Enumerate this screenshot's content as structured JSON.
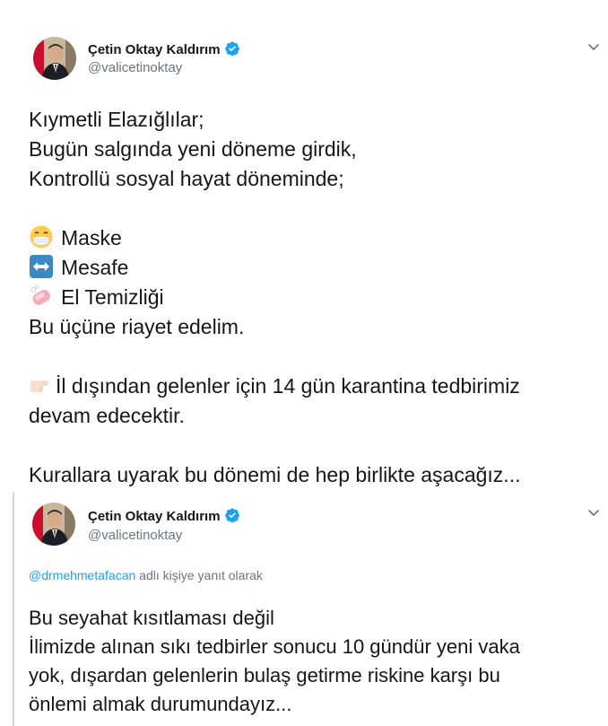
{
  "tweets": [
    {
      "author": {
        "name": "Çetin Oktay Kaldırım",
        "handle": "@valicetinoktay"
      },
      "lines": [
        "Kıymetli Elazığlılar;",
        "Bugün salgında yeni döneme girdik,",
        "Kontrollü sosyal hayat döneminde;",
        "",
        "Maske",
        "Mesafe",
        "El Temizliği",
        "Bu üçüne riayet edelim.",
        "",
        "İl dışından gelenler için 14 gün karantina tedbirimiz",
        "devam edecektir.",
        "",
        "Kurallara uyarak bu dönemi de hep birlikte aşacağız..."
      ],
      "emoji_icons": [
        "mask-face-emoji",
        "left-right-arrow-emoji",
        "soap-emoji",
        "pointing-right-hand-emoji"
      ]
    },
    {
      "author": {
        "name": "Çetin Oktay Kaldırım",
        "handle": "@valicetinoktay"
      },
      "reply_mention": "@drmehmetafacan",
      "reply_suffix": " adlı kişiye yanıt olarak",
      "lines": [
        "Bu seyahat kısıtlaması değil",
        "İlimizde alınan sıkı tedbirler sonucu 10 gündür yeni vaka",
        "yok, dışardan gelenlerin bulaş getirme riskine karşı bu",
        "önlemi almak durumundayız..."
      ]
    }
  ],
  "colors": {
    "accent": "#1da1f2",
    "text": "#14171a",
    "secondary": "#657786",
    "thread_line": "#cfd9de"
  }
}
